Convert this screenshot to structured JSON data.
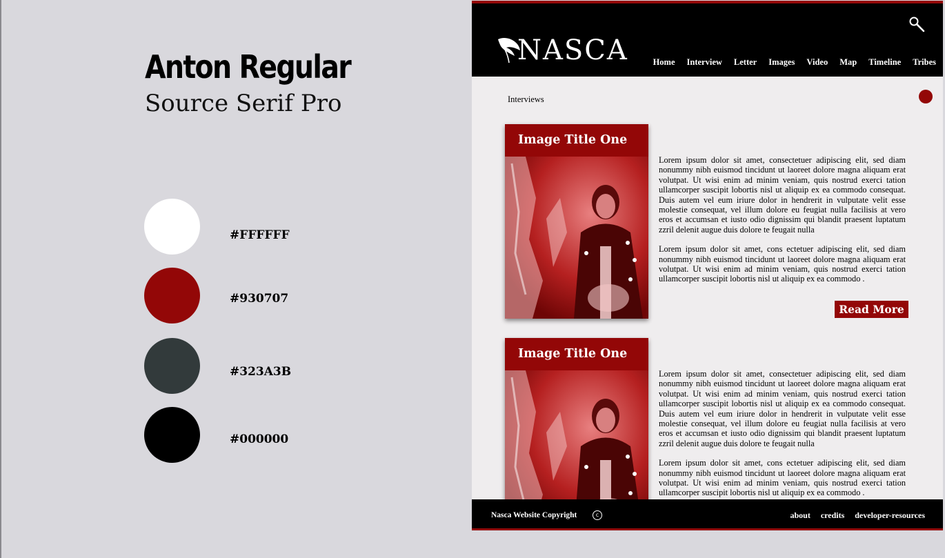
{
  "guide": {
    "display_font": "Anton Regular",
    "body_font": "Source Serif Pro",
    "swatches": [
      {
        "hex": "#FFFFFF",
        "color": "#FFFFFF"
      },
      {
        "hex": "#930707",
        "color": "#930707"
      },
      {
        "hex": "#323A3B",
        "color": "#323A3B"
      },
      {
        "hex": "#000000",
        "color": "#000000"
      }
    ]
  },
  "site": {
    "logo_text": "NASCA",
    "nav": [
      "Home",
      "Interview",
      "Letter",
      "Images",
      "Video",
      "Map",
      "Timeline",
      "Tribes"
    ],
    "breadcrumb": "Interviews",
    "articles": [
      {
        "title": "Image Title One",
        "paragraph1": "Lorem ipsum dolor sit amet, consectetuer adipiscing elit, sed diam nonummy nibh euismod tincidunt ut laoreet dolore magna aliquam erat volutpat. Ut wisi enim ad minim veniam, quis nostrud exerci tation ullamcorper suscipit lobortis nisl ut aliquip ex ea commodo consequat. Duis autem vel eum iriure dolor in hendrerit in vulputate velit esse molestie consequat, vel illum dolore eu feugiat nulla facilisis at vero eros et accumsan et iusto odio dignissim qui blandit praesent luptatum zzril delenit augue duis dolore te feugait nulla",
        "paragraph2": "Lorem ipsum dolor sit amet, cons ectetuer adipiscing elit, sed diam nonummy nibh euismod tincidunt ut laoreet dolore magna aliquam erat volutpat. Ut wisi enim ad minim veniam, quis nostrud exerci tation ullamcorper suscipit lobortis nisl ut aliquip ex ea commodo .",
        "read_more": "Read More"
      },
      {
        "title": "Image Title One",
        "paragraph1": "Lorem ipsum dolor sit amet, consectetuer adipiscing elit, sed diam nonummy nibh euismod tincidunt ut laoreet dolore magna aliquam erat volutpat. Ut wisi enim ad minim veniam, quis nostrud exerci tation ullamcorper suscipit lobortis nisl ut aliquip ex ea commodo consequat. Duis autem vel eum iriure dolor in hendrerit in vulputate velit esse molestie consequat, vel illum dolore eu feugiat nulla facilisis at vero eros et accumsan et iusto odio dignissim qui blandit praesent luptatum zzril delenit augue duis dolore te feugait nulla",
        "paragraph2": "Lorem ipsum dolor sit amet, cons ectetuer adipiscing elit, sed diam nonummy nibh euismod tincidunt ut laoreet dolore magna aliquam erat volutpat. Ut wisi enim ad minim veniam, quis nostrud exerci tation ullamcorper suscipit lobortis nisl ut aliquip ex ea commodo ."
      }
    ],
    "footer": {
      "copyright": "Nasca Website Copyright",
      "copyright_symbol": "c",
      "links": [
        "about",
        "credits",
        "developer-resources"
      ]
    },
    "colors": {
      "accent": "#930707",
      "header_bg": "#000000",
      "page_bg": "#efedee"
    },
    "icons": {
      "search": "search-icon",
      "logo": "feather-icon",
      "copyright": "copyright-icon"
    }
  }
}
